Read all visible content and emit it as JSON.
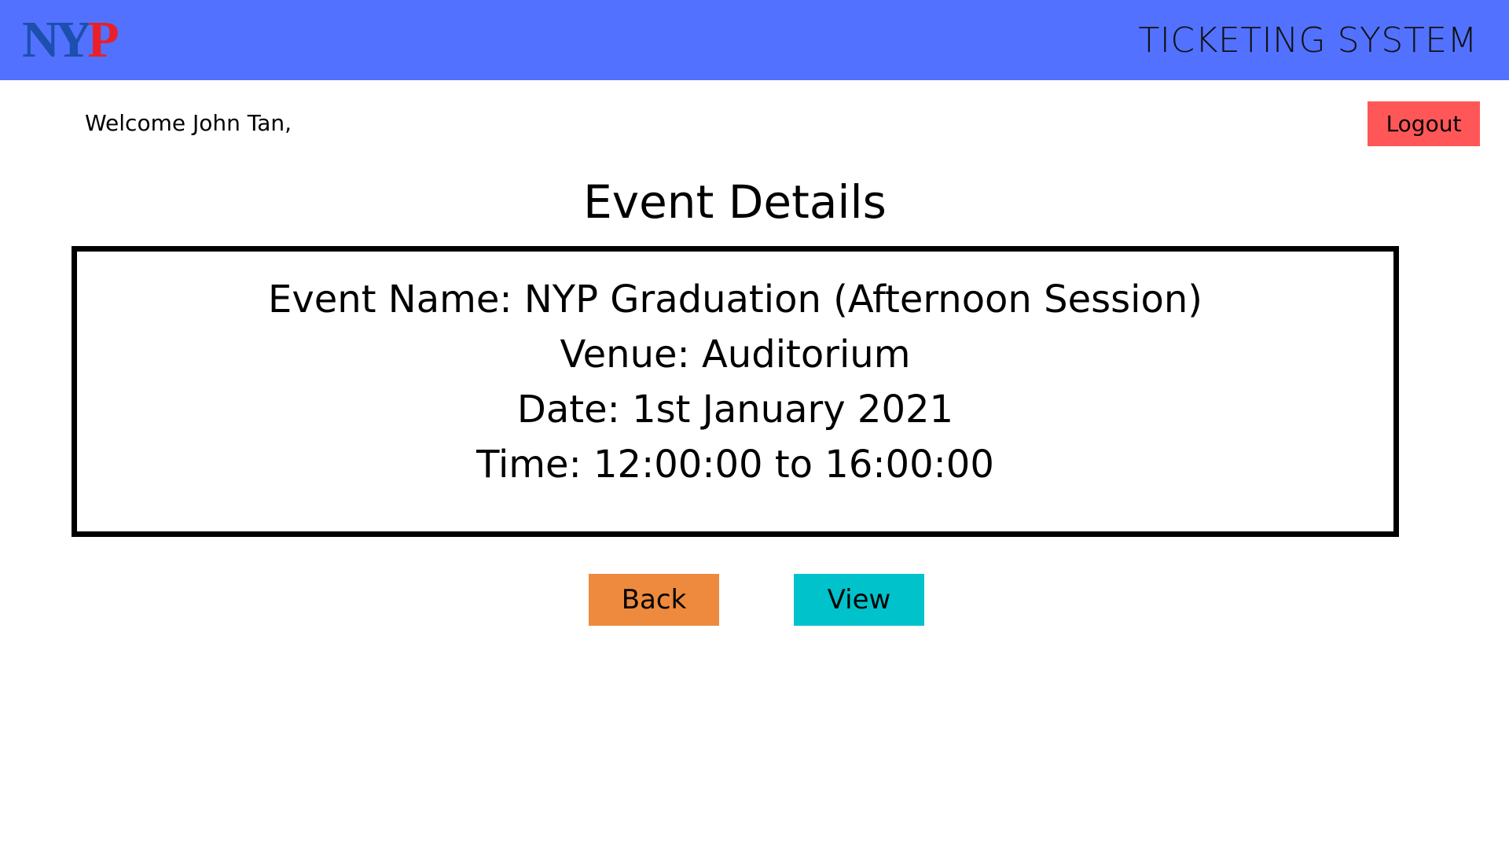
{
  "header": {
    "logo_text_ny": "NY",
    "logo_text_p": "P",
    "title": "TICKETING SYSTEM",
    "background_color": "#5271ff"
  },
  "user_bar": {
    "welcome_text": "Welcome John Tan,",
    "logout_label": "Logout",
    "logout_color": "#ff5757"
  },
  "main": {
    "title": "Event Details",
    "details": {
      "event_name": "Event Name: NYP Graduation (Afternoon Session)",
      "venue": "Venue: Auditorium",
      "date": "Date: 1st January 2021",
      "time": "Time: 12:00:00 to 16:00:00"
    }
  },
  "actions": {
    "back_label": "Back",
    "back_color": "#ed8a3e",
    "view_label": "View",
    "view_color": "#00c2cb"
  }
}
